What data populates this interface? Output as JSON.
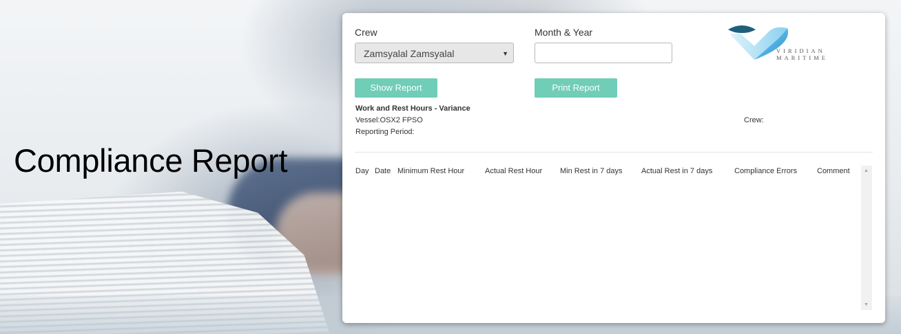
{
  "page": {
    "title": "Compliance Report"
  },
  "form": {
    "crew_label": "Crew",
    "crew_selected": "Zamsyalal Zamsyalal",
    "month_year_label": "Month & Year",
    "month_year_value": "",
    "show_report_label": "Show Report",
    "print_report_label": "Print Report"
  },
  "logo": {
    "line1": "VIRIDIAN",
    "line2": "MARITIME"
  },
  "report": {
    "title": "Work and Rest Hours - Variance",
    "vessel": "Vessel:OSX2 FPSO",
    "reporting_period": "Reporting Period:",
    "crew": "Crew:"
  },
  "table": {
    "columns": [
      "Day",
      "Date",
      "Minimum Rest Hour",
      "Actual Rest Hour",
      "Min Rest in 7 days",
      "Actual Rest in 7 days",
      "Compliance Errors",
      "Comment"
    ],
    "rows": []
  },
  "icons": {
    "dropdown": "caret-down-icon",
    "scroll_up": "scroll-up-icon",
    "scroll_down": "scroll-down-icon"
  },
  "colors": {
    "button": "#6fcdb8",
    "logo_dark": "#1f5f7a",
    "logo_light": "#4bb3e8"
  }
}
